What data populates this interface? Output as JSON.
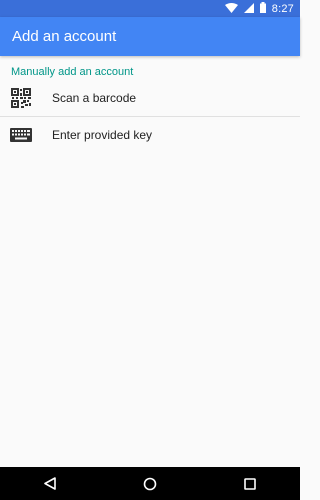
{
  "status_bar": {
    "time": "8:27",
    "icons": [
      "wifi-icon",
      "cell-signal-icon",
      "battery-icon"
    ]
  },
  "app_bar": {
    "title": "Add an account"
  },
  "section": {
    "header": "Manually add an account"
  },
  "options": [
    {
      "label": "Scan a barcode",
      "icon": "qr-code-icon"
    },
    {
      "label": "Enter provided key",
      "icon": "keyboard-icon"
    }
  ],
  "nav_bar": {
    "icons": [
      "back-icon",
      "home-icon",
      "recents-icon"
    ]
  },
  "colors": {
    "status_bar": "#3a6fd9",
    "app_bar": "#4285f4",
    "section_header": "#009688",
    "background": "#fafafa"
  }
}
